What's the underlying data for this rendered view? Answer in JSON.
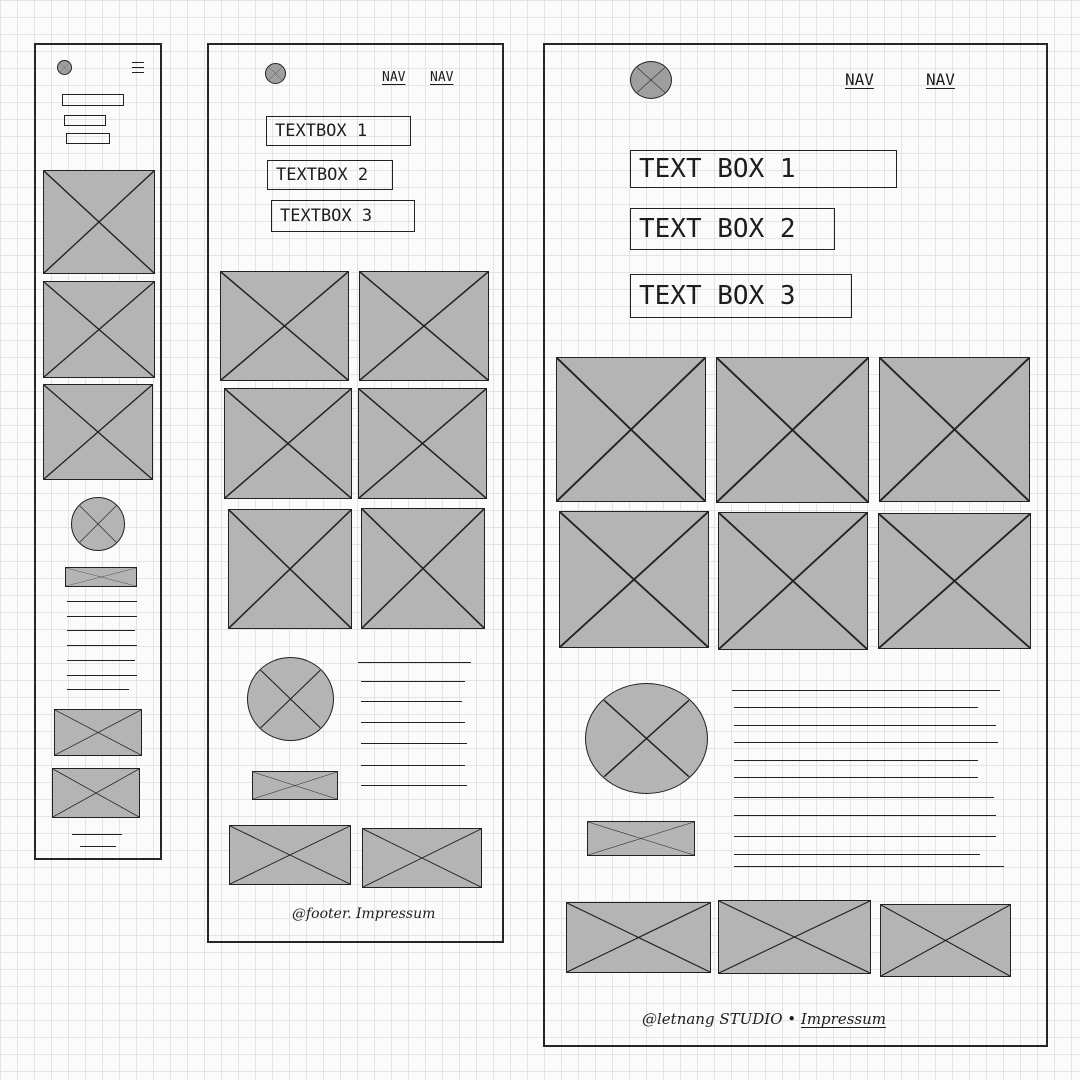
{
  "sketch": {
    "cross_icon": "placeholder-x-icon",
    "menu_icon": "hamburger-menu-icon",
    "fill_color": "#b4b4b4",
    "ink_color": "#222222"
  },
  "tablet": {
    "nav": [
      "NAV",
      "NAV"
    ],
    "text_boxes": [
      "TEXTBOX 1",
      "TEXTBOX 2",
      "TEXTBOX 3"
    ],
    "footer": "@footer. Impressum"
  },
  "desktop": {
    "nav": [
      "NAV",
      "NAV"
    ],
    "text_boxes": [
      "TEXT BOX 1",
      "TEXT BOX 2",
      "TEXT BOX 3"
    ],
    "footer_prefix": "@letnang STUDIO • ",
    "footer_link": "Impressum"
  }
}
